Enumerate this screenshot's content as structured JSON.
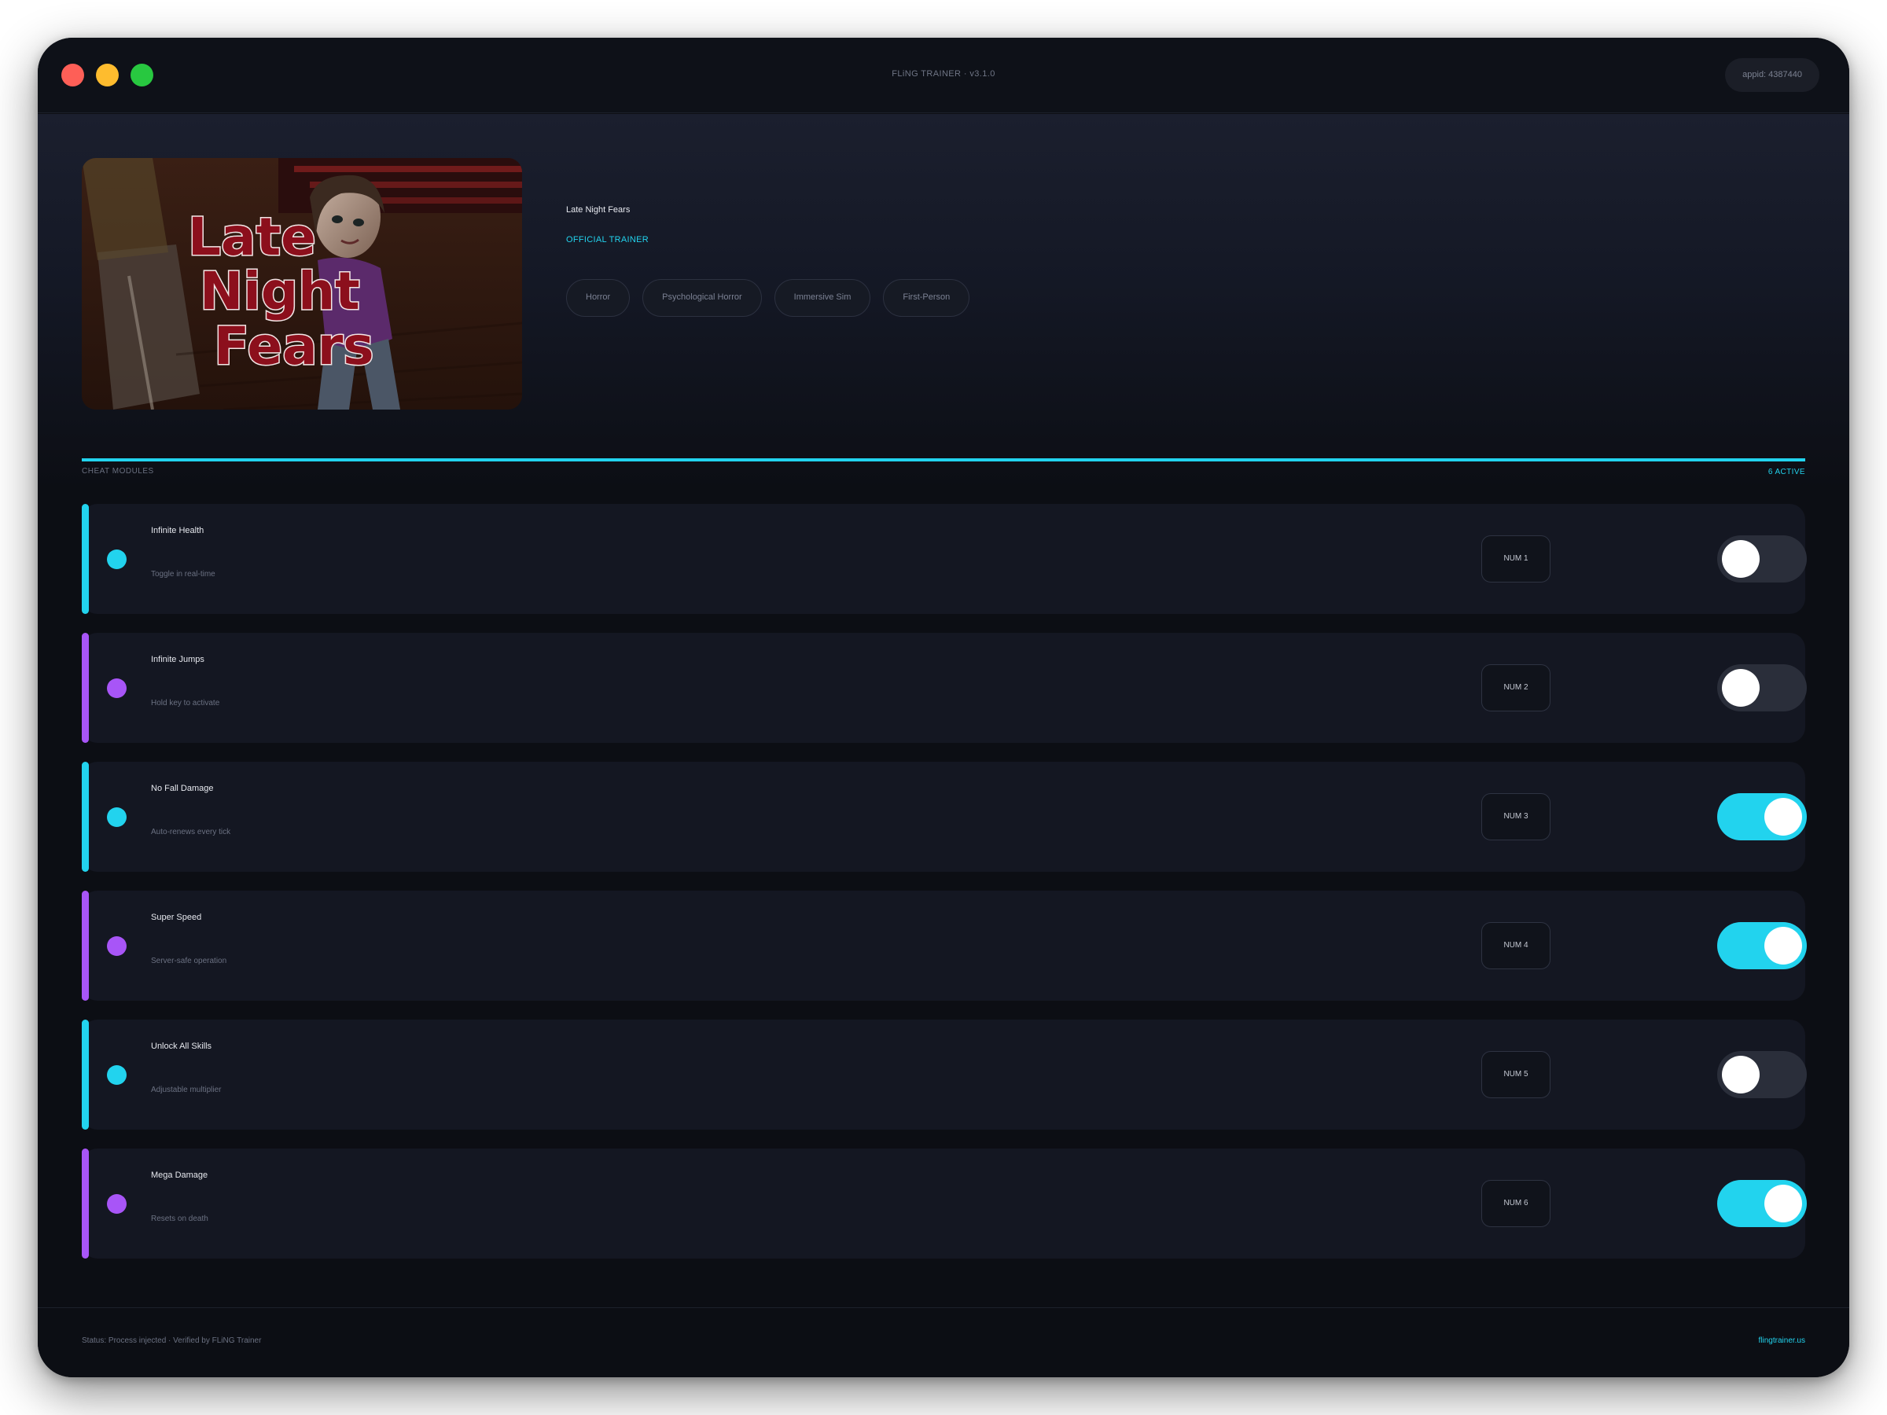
{
  "window": {
    "title": "FLiNG TRAINER · v3.1.0",
    "appid_label": "appid: 4387440"
  },
  "game": {
    "cover_text": [
      "Late",
      "Night",
      "Fears"
    ],
    "title": "Late Night Fears",
    "badge": "OFFICIAL TRAINER",
    "tags": [
      "Horror",
      "Psychological Horror",
      "Immersive Sim",
      "First-Person"
    ]
  },
  "section": {
    "label": "CHEAT MODULES",
    "active_count": "6 ACTIVE"
  },
  "colors": {
    "accent_cyan": "#22d3ee",
    "accent_purple": "#a855f7",
    "toggle_off": "#2a2e3a"
  },
  "modules": [
    {
      "name": "Infinite Health",
      "desc": "Toggle in real-time",
      "key": "NUM 1",
      "accent": "#22d3ee",
      "enabled": false
    },
    {
      "name": "Infinite Jumps",
      "desc": "Hold key to activate",
      "key": "NUM 2",
      "accent": "#a855f7",
      "enabled": false
    },
    {
      "name": "No Fall Damage",
      "desc": "Auto-renews every tick",
      "key": "NUM 3",
      "accent": "#22d3ee",
      "enabled": true
    },
    {
      "name": "Super Speed",
      "desc": "Server-safe operation",
      "key": "NUM 4",
      "accent": "#a855f7",
      "enabled": true
    },
    {
      "name": "Unlock All Skills",
      "desc": "Adjustable multiplier",
      "key": "NUM 5",
      "accent": "#22d3ee",
      "enabled": false
    },
    {
      "name": "Mega Damage",
      "desc": "Resets on death",
      "key": "NUM 6",
      "accent": "#a855f7",
      "enabled": true
    }
  ],
  "footer": {
    "status": "Status: Process injected · Verified by FLiNG Trainer",
    "site": "flingtrainer.us"
  }
}
